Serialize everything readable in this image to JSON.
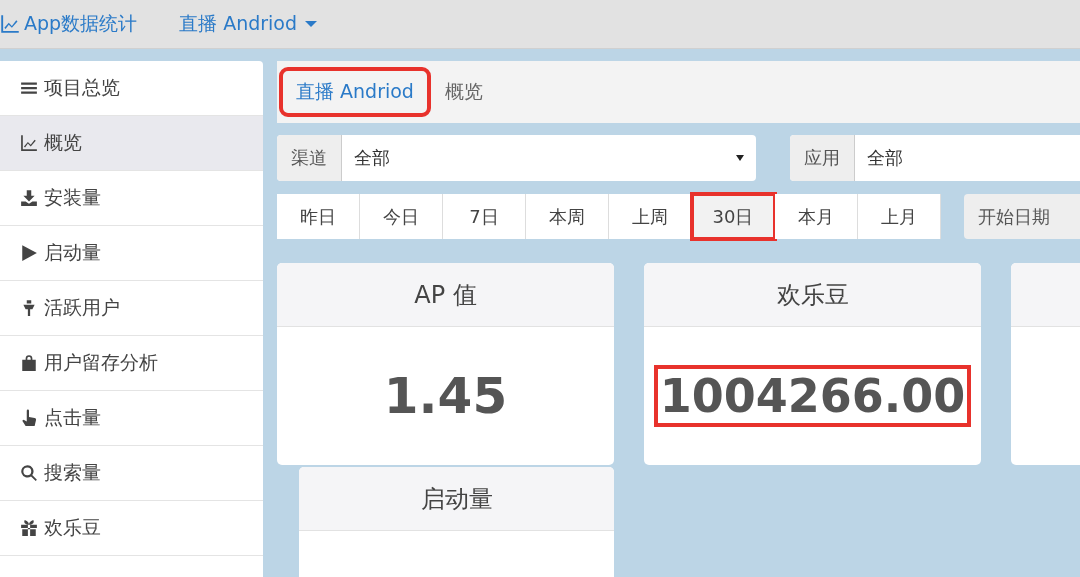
{
  "navbar": {
    "brand": "App数据统计",
    "dropdown": "直播 Andriod"
  },
  "sidebar": {
    "items": [
      {
        "label": "项目总览",
        "selected": false
      },
      {
        "label": "概览",
        "selected": true
      },
      {
        "label": "安装量",
        "selected": false
      },
      {
        "label": "启动量",
        "selected": false
      },
      {
        "label": "活跃用户",
        "selected": false
      },
      {
        "label": "用户留存分析",
        "selected": false
      },
      {
        "label": "点击量",
        "selected": false
      },
      {
        "label": "搜索量",
        "selected": false
      },
      {
        "label": "欢乐豆",
        "selected": false
      }
    ]
  },
  "breadcrumb": [
    {
      "label": "直播 Andriod",
      "link": true,
      "highlighted": true
    },
    {
      "label": "概览",
      "link": false,
      "highlighted": false
    }
  ],
  "filters": [
    {
      "label": "渠道",
      "value": "全部"
    },
    {
      "label": "应用",
      "value": "全部"
    }
  ],
  "ranges": [
    {
      "label": "昨日",
      "selected": false,
      "highlighted": false
    },
    {
      "label": "今日",
      "selected": false,
      "highlighted": false
    },
    {
      "label": "7日",
      "selected": false,
      "highlighted": false
    },
    {
      "label": "本周",
      "selected": false,
      "highlighted": false
    },
    {
      "label": "上周",
      "selected": false,
      "highlighted": false
    },
    {
      "label": "30日",
      "selected": true,
      "highlighted": true
    },
    {
      "label": "本月",
      "selected": false,
      "highlighted": false
    },
    {
      "label": "上月",
      "selected": false,
      "highlighted": false
    }
  ],
  "start_date": {
    "label": "开始日期"
  },
  "cards": [
    {
      "kind": "stat",
      "title": "AP 值",
      "value": "1.45",
      "highlighted": false
    },
    {
      "kind": "stat",
      "title": "欢乐豆",
      "value": "1004266.00",
      "highlighted": true
    },
    {
      "kind": "clipped"
    },
    {
      "kind": "header",
      "title": "启动量"
    }
  ]
}
